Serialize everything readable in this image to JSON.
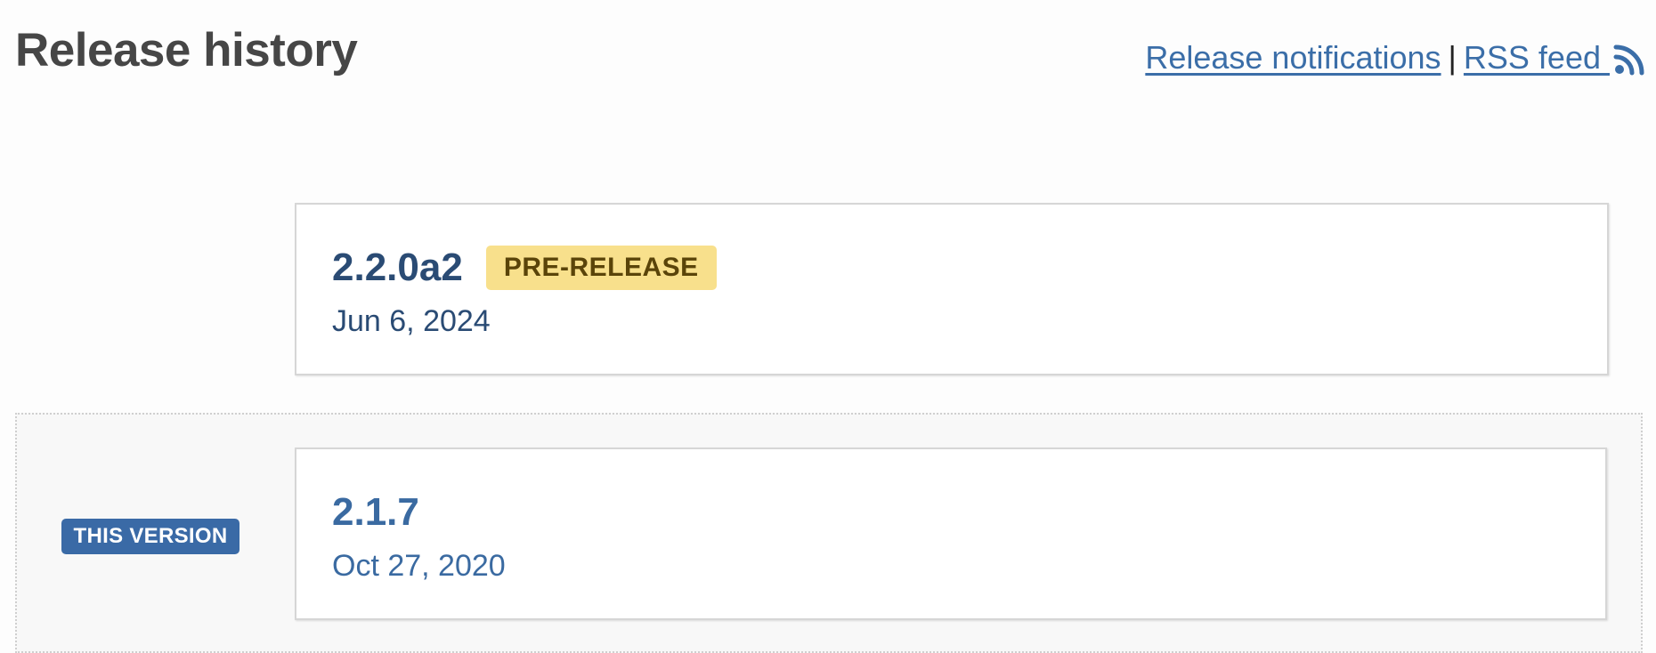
{
  "header": {
    "title": "Release history",
    "links": {
      "notifications": "Release notifications",
      "separator": "|",
      "rss": "RSS feed "
    },
    "rss_icon": "rss-icon"
  },
  "releases": [
    {
      "version": "2.2.0a2",
      "badge": "PRE-RELEASE",
      "date": "Jun 6, 2024"
    },
    {
      "version": "2.1.7",
      "date": "Oct 27, 2020",
      "current_label": "THIS VERSION"
    }
  ],
  "colors": {
    "link": "#3b6ea8",
    "prerelease_badge": "#f8e08c",
    "this_version_badge": "#3a6aa6",
    "version_text": "#2a4b74"
  }
}
